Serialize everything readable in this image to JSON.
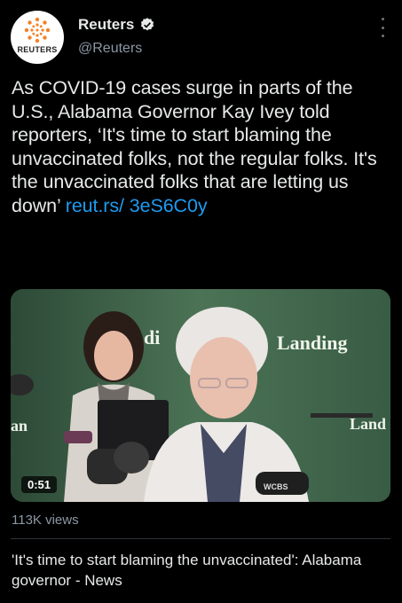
{
  "tweet": {
    "author": {
      "name": "Reuters",
      "handle": "@Reuters",
      "avatar_text": "REUTERS",
      "verified": true
    },
    "text_main": "As COVID-19 cases surge in parts of the U.S., Alabama Governor Kay Ivey told reporters, ‘It's time to start blaming the unvaccinated folks, not the regular folks. It's the unvaccinated folks that are letting us down’ ",
    "link_text": "reut.rs/ 3eS6C0y",
    "media": {
      "duration": "0:51",
      "backdrop_text_1": "Landing",
      "backdrop_text_2": "di",
      "backdrop_text_3": "Land",
      "backdrop_text_4": "an",
      "mic_label": "WCBS"
    },
    "views": "113K views",
    "card_title": "'It's time to start blaming the unvaccinated': Alabama governor - News"
  },
  "colors": {
    "background": "#000000",
    "link": "#1d9bf0",
    "secondary_text": "#8b98a5",
    "verified_badge": "#1d9bf0",
    "logo_orange": "#f58025"
  },
  "icons": [
    "reuters-logo-icon",
    "verified-badge-icon",
    "more-options-icon"
  ]
}
